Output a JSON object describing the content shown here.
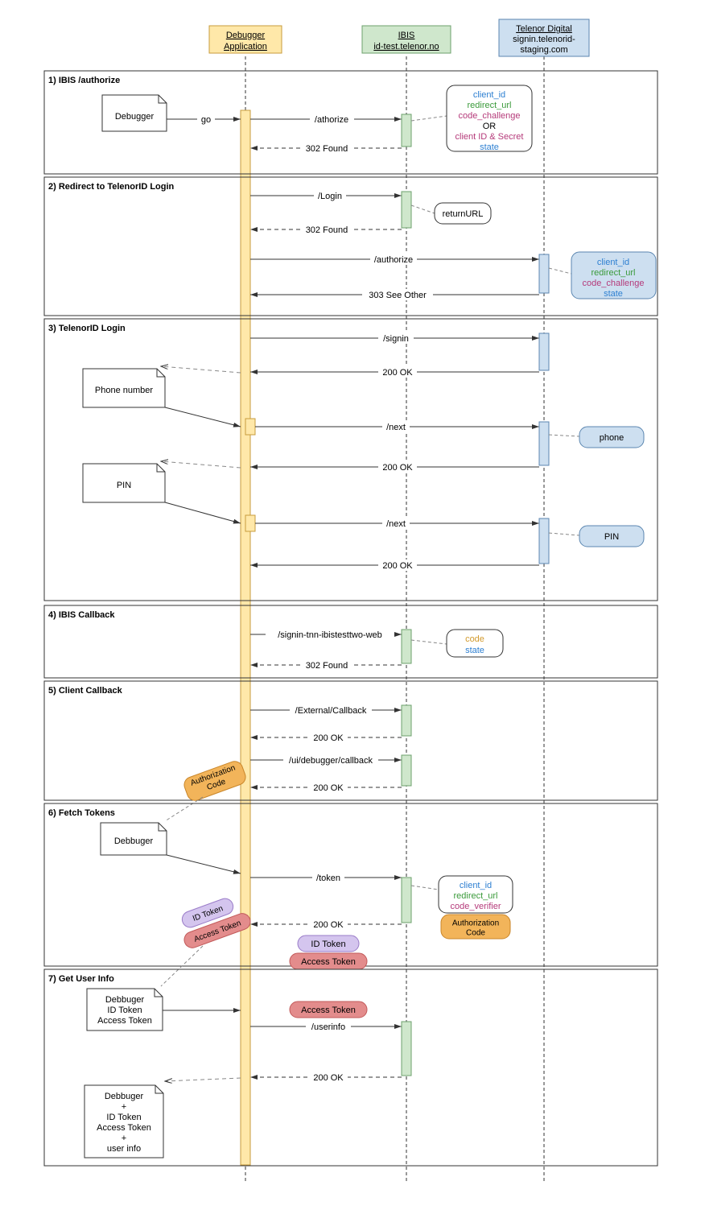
{
  "participants": {
    "debugger": {
      "title1": "Debugger",
      "title2": "Application"
    },
    "ibis": {
      "title1": "IBIS",
      "title2": "id-test.telenor.no"
    },
    "telenor": {
      "title1": "Telenor Digital",
      "title2": "signin.telenorid-",
      "title3": "staging.com"
    }
  },
  "sections": {
    "s1": "1) IBIS /authorize",
    "s2": "2) Redirect to TelenorID Login",
    "s3": "3) TelenorID Login",
    "s4": "4) IBIS Callback",
    "s5": "5) Client Callback",
    "s6": "6) Fetch Tokens",
    "s7": "7) Get User Info"
  },
  "notes": {
    "debugger": "Debugger",
    "phone": "Phone number",
    "pin": "PIN",
    "debbuger": "Debbuger",
    "dbg7a_1": "Debbuger",
    "dbg7a_2": "ID Token",
    "dbg7a_3": "Access Token",
    "dbg7b_1": "Debbuger",
    "dbg7b_2": "+",
    "dbg7b_3": "ID Token",
    "dbg7b_4": "Access Token",
    "dbg7b_5": "+",
    "dbg7b_6": "user info"
  },
  "msgs": {
    "go": "go",
    "authorize": "/athorize",
    "found": "302 Found",
    "login": "/Login",
    "authorize2": "/authorize",
    "seeOther": "303 See Other",
    "signin": "/signin",
    "ok": "200 OK",
    "next": "/next",
    "signinCb": "/signin-tnn-ibistesttwo-web",
    "extCb": "/External/Callback",
    "uiCb": "/ui/debugger/callback",
    "token": "/token",
    "userinfo": "/userinfo"
  },
  "params": {
    "authorize": {
      "l1": "client_id",
      "l2": "redirect_url",
      "l3": "code_challenge",
      "l4": "OR",
      "l5": "client ID & Secret",
      "l6": "state"
    },
    "returnURL": "returnURL",
    "authorize2": {
      "l1": "client_id",
      "l2": "redirect_url",
      "l3": "code_challenge",
      "l4": "state"
    },
    "phone": "phone",
    "pin": "PIN",
    "cb": {
      "l1": "code",
      "l2": "state"
    },
    "token": {
      "l1": "client_id",
      "l2": "redirect_url",
      "l3": "code_verifier"
    }
  },
  "badges": {
    "authCode": "Authorization Code",
    "authCode2a": "Authorization",
    "authCode2b": "Code",
    "idToken": "ID Token",
    "accessToken": "Access Token"
  }
}
